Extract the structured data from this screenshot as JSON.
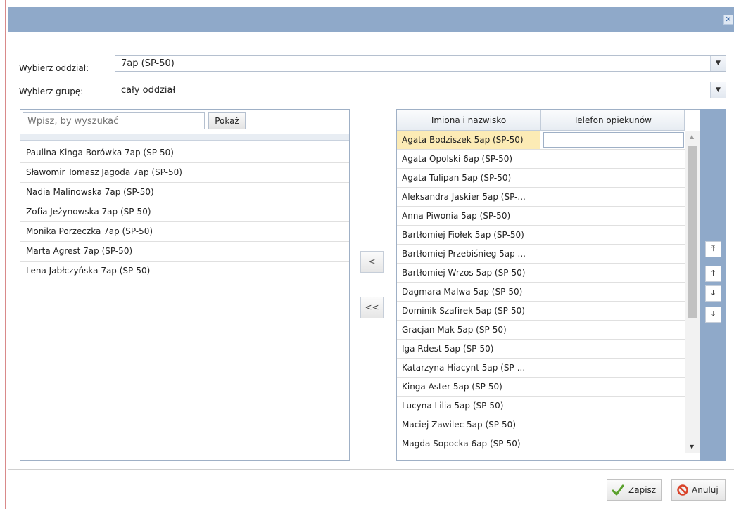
{
  "window": {
    "close_label": "✕"
  },
  "class_select": {
    "label": "Wybierz oddział:",
    "value": "7ap (SP-50)"
  },
  "group_select": {
    "label": "Wybierz grupę:",
    "value": "cały oddział"
  },
  "search": {
    "placeholder": "Wpisz, by wyszukać",
    "button_label": "Pokaż"
  },
  "available_students": [
    "Paulina Kinga Borówka 7ap (SP-50)",
    "Sławomir Tomasz Jagoda 7ap (SP-50)",
    "Nadia Malinowska 7ap (SP-50)",
    "Zofia Jeżynowska 7ap (SP-50)",
    "Monika Porzeczka 7ap (SP-50)",
    "Marta Agrest 7ap (SP-50)",
    "Lena Jabłczyńska 7ap (SP-50)"
  ],
  "transfer": {
    "move_one_label": "<",
    "move_all_label": "<<"
  },
  "grid": {
    "col_name": "Imiona i nazwisko",
    "col_phone": "Telefon opiekunów",
    "rows": [
      "Agata Bodziszek 5ap (SP-50)",
      "Agata Opolski 6ap (SP-50)",
      "Agata Tulipan 5ap (SP-50)",
      "Aleksandra Jaskier 5ap (SP-...",
      "Anna Piwonia 5ap (SP-50)",
      "Bartłomiej Fiołek 5ap (SP-50)",
      "Bartłomiej Przebiśnieg 5ap ...",
      "Bartłomiej Wrzos 5ap (SP-50)",
      "Dagmara Malwa 5ap (SP-50)",
      "Dominik Szafirek 5ap (SP-50)",
      "Gracjan Mak 5ap (SP-50)",
      "Iga Rdest 5ap (SP-50)",
      "Katarzyna Hiacynt 5ap (SP-...",
      "Kinga Aster 5ap (SP-50)",
      "Lucyna Lilia 5ap (SP-50)",
      "Maciej Zawilec 5ap (SP-50)",
      "Magda Sopocka 6ap (SP-50)"
    ]
  },
  "order_buttons": {
    "top": "⤒",
    "up": "↑",
    "down": "↓",
    "bottom": "⤓"
  },
  "footer": {
    "save_label": "Zapisz",
    "cancel_label": "Anuluj"
  },
  "colors": {
    "titlebar": "#8fa9c9",
    "selected_row": "#fcebb5",
    "save_icon": "#5aa02c",
    "cancel_icon": "#d9442b"
  }
}
